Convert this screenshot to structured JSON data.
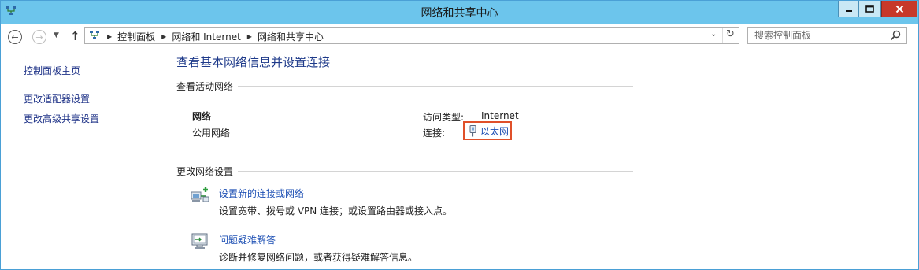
{
  "window": {
    "title": "网络和共享中心",
    "controls": {
      "minimize": "minimize",
      "maximize": "maximize",
      "close": "close"
    }
  },
  "address_bar": {
    "breadcrumbs": [
      "控制面板",
      "网络和 Internet",
      "网络和共享中心"
    ],
    "search_placeholder": "搜索控制面板"
  },
  "sidebar": {
    "items": [
      {
        "label": "控制面板主页"
      },
      {
        "label": "更改适配器设置"
      },
      {
        "label": "更改高级共享设置"
      }
    ]
  },
  "main": {
    "title": "查看基本网络信息并设置连接",
    "active_networks": {
      "heading": "查看活动网络",
      "network_name": "网络",
      "network_type": "公用网络",
      "access_type_label": "访问类型:",
      "access_type_value": "Internet",
      "connections_label": "连接:",
      "connection_name": "以太网",
      "connection_icon": "ethernet-adapter-icon"
    },
    "change_settings": {
      "heading": "更改网络设置",
      "tasks": [
        {
          "icon": "new-connection-icon",
          "title": "设置新的连接或网络",
          "description": "设置宽带、拨号或 VPN 连接；或设置路由器或接入点。"
        },
        {
          "icon": "troubleshoot-icon",
          "title": "问题疑难解答",
          "description": "诊断并修复网络问题，或者获得疑难解答信息。"
        }
      ]
    }
  },
  "colors": {
    "titlebar": "#6cc5ec",
    "close_button": "#c7382a",
    "link": "#1e50b4",
    "highlight_box": "#e0502a"
  }
}
